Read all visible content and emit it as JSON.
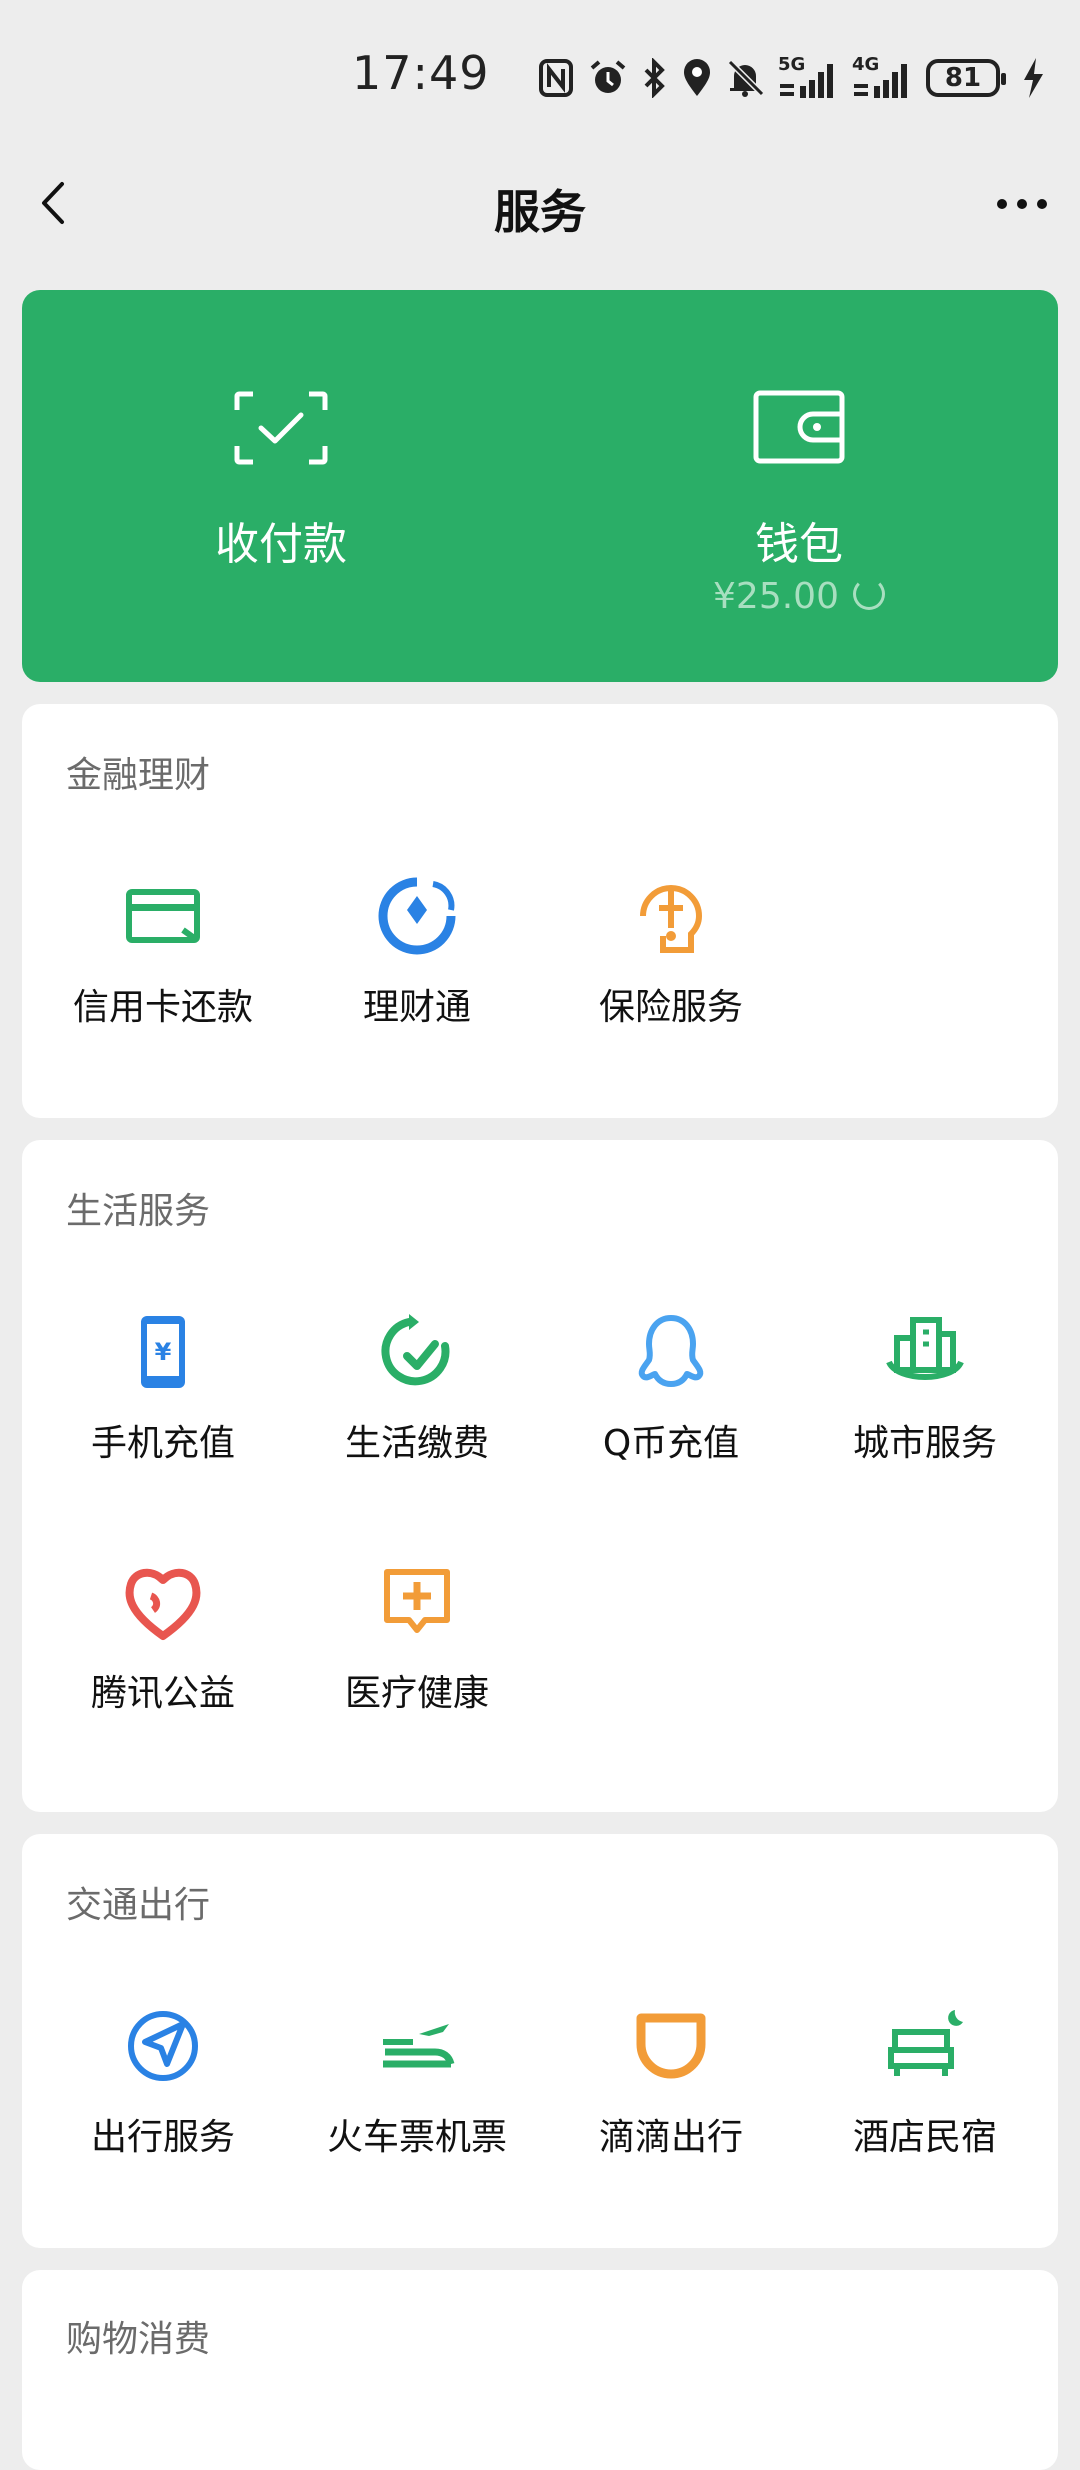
{
  "status_bar": {
    "time": "17:49",
    "net1": "5G",
    "net2": "4G",
    "battery": "81"
  },
  "nav": {
    "title": "服务"
  },
  "hero": {
    "pay": {
      "label": "收付款"
    },
    "wallet": {
      "label": "钱包",
      "balance": "¥25.00"
    }
  },
  "sections": {
    "finance": {
      "title": "金融理财",
      "items": [
        {
          "label": "信用卡还款",
          "icon": "credit-card-icon"
        },
        {
          "label": "理财通",
          "icon": "wealth-icon"
        },
        {
          "label": "保险服务",
          "icon": "insurance-icon"
        }
      ]
    },
    "life": {
      "title": "生活服务",
      "items": [
        {
          "label": "手机充值",
          "icon": "phone-topup-icon"
        },
        {
          "label": "生活缴费",
          "icon": "bill-payment-icon"
        },
        {
          "label": "Q币充值",
          "icon": "qq-coin-icon"
        },
        {
          "label": "城市服务",
          "icon": "city-service-icon"
        },
        {
          "label": "腾讯公益",
          "icon": "charity-heart-icon"
        },
        {
          "label": "医疗健康",
          "icon": "medical-icon"
        }
      ]
    },
    "travel": {
      "title": "交通出行",
      "items": [
        {
          "label": "出行服务",
          "icon": "navigation-icon"
        },
        {
          "label": "火车票机票",
          "icon": "train-plane-icon"
        },
        {
          "label": "滴滴出行",
          "icon": "didi-icon"
        },
        {
          "label": "酒店民宿",
          "icon": "hotel-bed-icon"
        }
      ]
    },
    "shopping": {
      "title": "购物消费"
    }
  },
  "colors": {
    "green": "#2aae67",
    "blue": "#2a82e4",
    "orange": "#f29c38",
    "red": "#e8564f",
    "bg": "#ededed"
  }
}
